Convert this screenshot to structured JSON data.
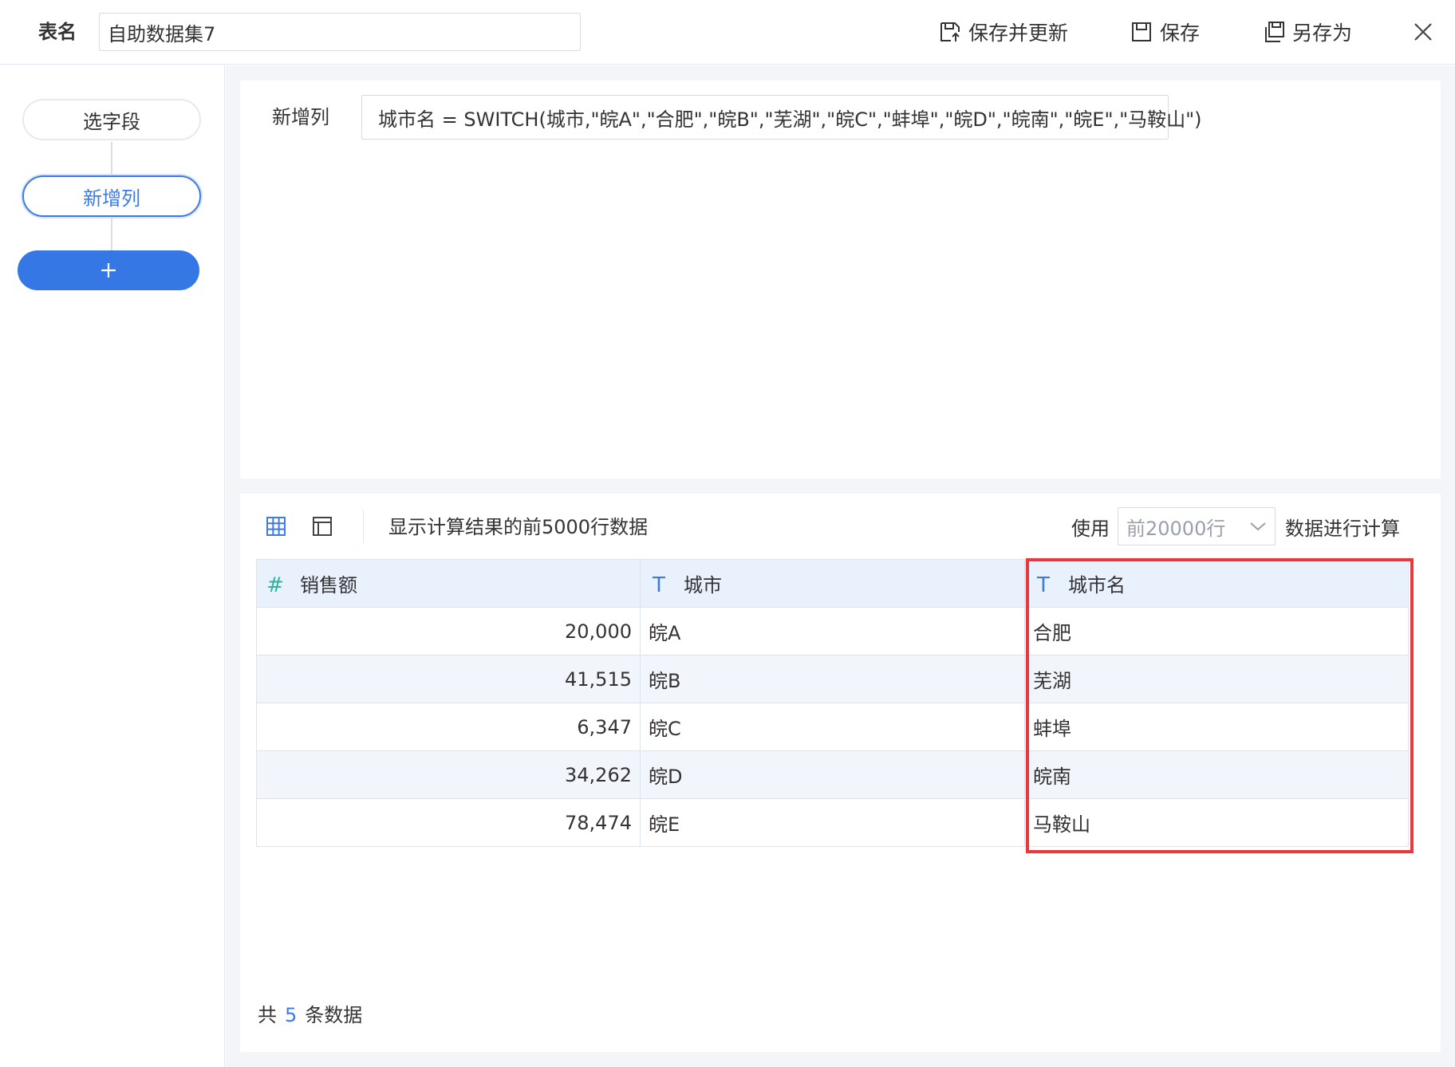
{
  "header": {
    "table_name_label": "表名",
    "table_name_value": "自助数据集7",
    "buttons": {
      "save_and_update": "保存并更新",
      "save": "保存",
      "save_as": "另存为"
    }
  },
  "steps": {
    "items": [
      {
        "label": "选字段"
      },
      {
        "label": "新增列"
      }
    ]
  },
  "formula": {
    "label": "新增列",
    "expression": "城市名 = SWITCH(城市,\"皖A\",\"合肥\",\"皖B\",\"芜湖\",\"皖C\",\"蚌埠\",\"皖D\",\"皖南\",\"皖E\",\"马鞍山\")"
  },
  "preview": {
    "note": "显示计算结果的前5000行数据",
    "use_label": "使用",
    "rows_option": "前20000行",
    "calc_label": "数据进行计算",
    "columns": [
      {
        "type_icon": "#",
        "name": "销售额"
      },
      {
        "type_icon": "T",
        "name": "城市"
      },
      {
        "type_icon": "T",
        "name": "城市名"
      }
    ],
    "rows": [
      [
        "20,000",
        "皖A",
        "合肥"
      ],
      [
        "41,515",
        "皖B",
        "芜湖"
      ],
      [
        "6,347",
        "皖C",
        "蚌埠"
      ],
      [
        "34,262",
        "皖D",
        "皖南"
      ],
      [
        "78,474",
        "皖E",
        "马鞍山"
      ]
    ],
    "total_prefix": "共",
    "total_count": "5",
    "total_suffix": "条数据"
  },
  "colors": {
    "accent": "#3d7ae6",
    "add_button": "#3578e5",
    "highlight": "#e8383d",
    "number_type_icon": "#2eb3a0",
    "header_row": "#e9f1fc"
  }
}
